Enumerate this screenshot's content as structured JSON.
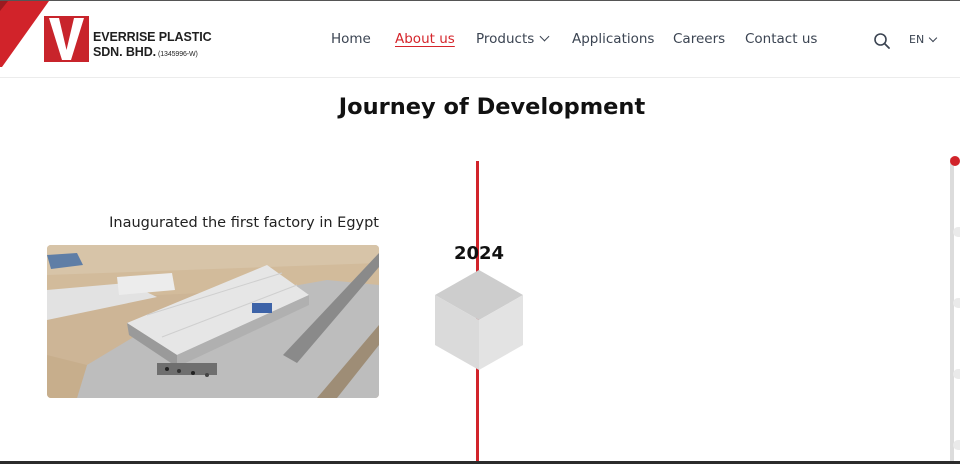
{
  "brand": {
    "line1": "EVERRISE PLASTIC",
    "line2": "SDN. BHD.",
    "reg": "(1345996-W)",
    "accent": "#d1232a"
  },
  "nav": {
    "items": [
      {
        "label": "Home",
        "active": false
      },
      {
        "label": "About us",
        "active": true
      },
      {
        "label": "Products",
        "active": false,
        "dropdown": true
      },
      {
        "label": "Applications",
        "active": false
      },
      {
        "label": "Careers",
        "active": false
      },
      {
        "label": "Contact us",
        "active": false
      }
    ],
    "search_icon": "search-icon",
    "language": "EN"
  },
  "page": {
    "title": "Journey of Development"
  },
  "timeline": {
    "current": {
      "year": "2024",
      "caption": "Inaugurated the first factory in Egypt",
      "image": "factory-aerial-photo"
    },
    "accent": "#d1232a"
  }
}
